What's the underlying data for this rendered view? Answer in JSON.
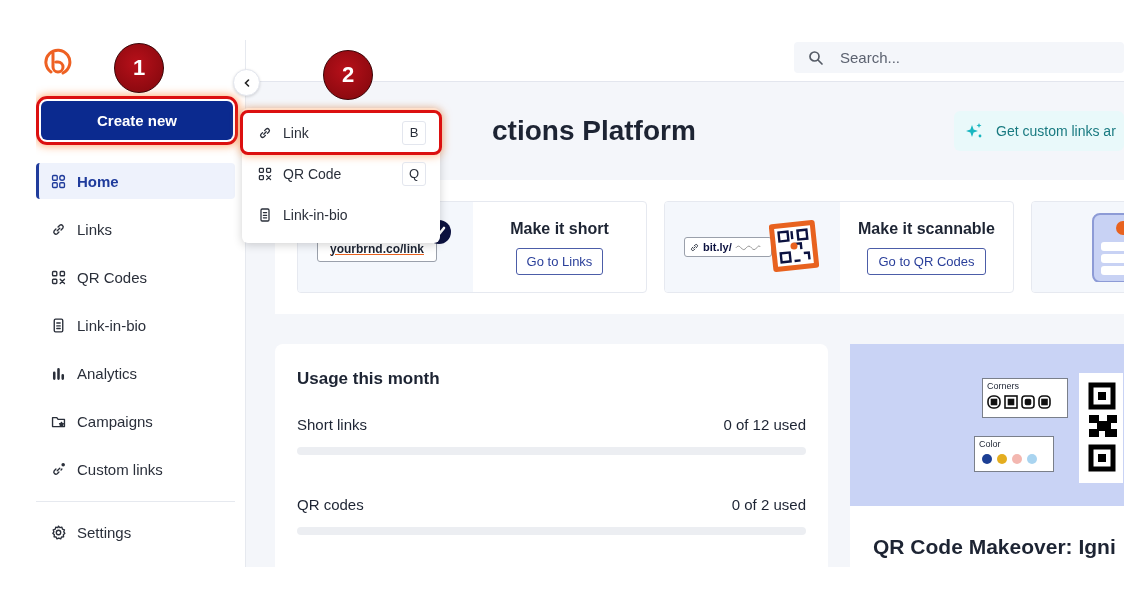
{
  "sidebar": {
    "create_button": "Create new",
    "items": [
      {
        "label": "Home",
        "selected": true
      },
      {
        "label": "Links",
        "selected": false
      },
      {
        "label": "QR Codes",
        "selected": false
      },
      {
        "label": "Link-in-bio",
        "selected": false
      },
      {
        "label": "Analytics",
        "selected": false
      },
      {
        "label": "Campaigns",
        "selected": false
      },
      {
        "label": "Custom links",
        "selected": false
      }
    ],
    "footer_items": [
      {
        "label": "Settings",
        "selected": false
      }
    ]
  },
  "create_menu": {
    "items": [
      {
        "label": "Link",
        "shortcut": "B"
      },
      {
        "label": "QR Code",
        "shortcut": "Q"
      },
      {
        "label": "Link-in-bio"
      }
    ]
  },
  "search": {
    "placeholder": "Search..."
  },
  "header": {
    "title": "ctions Platform",
    "promo": "Get custom links ar"
  },
  "cards": [
    {
      "kind": "short",
      "sample": "yourbrnd.co/link",
      "title": "Make it short",
      "button": "Go to Links"
    },
    {
      "kind": "qr",
      "sample": "bit.ly/",
      "title": "Make it scannable",
      "button": "Go to QR Codes"
    },
    {
      "kind": "bio"
    }
  ],
  "usage": {
    "title": "Usage this month",
    "rows": [
      {
        "label": "Short links",
        "reading": "0 of 12 used",
        "level": 0
      },
      {
        "label": "QR codes",
        "reading": "0 of 2 used",
        "level": 0
      }
    ]
  },
  "feature": {
    "corners_label": "Corners",
    "color_label": "Color",
    "swatches": [
      {
        "color": "#1c3f94"
      },
      {
        "color": "#e4ad1f"
      },
      {
        "color": "#f3b7b0"
      },
      {
        "color": "#a9d4f0"
      }
    ],
    "title": "QR Code Makeover: Igni"
  },
  "annotations": [
    {
      "number": "1"
    },
    {
      "number": "2"
    }
  ]
}
